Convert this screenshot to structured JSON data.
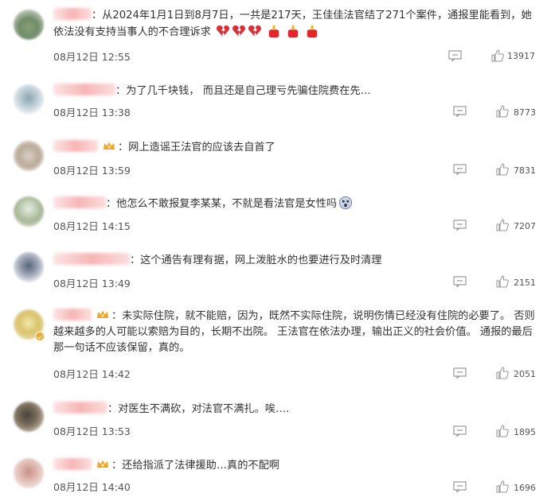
{
  "comments": [
    {
      "text": "：从2024年1月1日到8月7日，一共是217天，王佳佳法官结了271个案件，通报里能看到，她依法没有支持当事人的不合理诉求",
      "time": "08月12日 12:55",
      "likes": "13917"
    },
    {
      "text": "：为了几千块钱， 而且还是自己理亏先骗住院费在先…",
      "time": "08月12日 13:38",
      "likes": "8773"
    },
    {
      "text": "：网上造谣王法官的应该去自首了",
      "time": "08月12日 13:59",
      "likes": "7831"
    },
    {
      "text": "：他怎么不敢报复李某某，不就是看法官是女性吗",
      "time": "08月12日 14:15",
      "likes": "7207"
    },
    {
      "text": "：这个通告有理有据，网上泼脏水的也要进行及时清理",
      "time": "08月12日 13:49",
      "likes": "2151"
    },
    {
      "text": "：未实际住院，就不能赔，因为，既然不实际住院，说明伤情已经没有住院的必要了。 否则越来越多的人可能以索赔为目的，长期不出院。 王法官在依法办理，输出正义的社会价值。 通报的最后那一句话不应该保留，真的。",
      "time": "08月12日 14:42",
      "likes": "2051"
    },
    {
      "text": "：对医生不满砍，对法官不满扎。唉….",
      "time": "08月12日 13:53",
      "likes": "1895"
    },
    {
      "text": "：还给指派了法律援助…真的不配啊",
      "time": "08月12日 14:40",
      "likes": "1696"
    }
  ],
  "icons": {
    "reply": "comment-icon",
    "like": "thumbs-up-icon",
    "crown": "crown-badge-icon",
    "heart": "broken-heart-emoji",
    "candle": "candle-emoji",
    "face": "scared-face-emoji"
  },
  "colors": {
    "text": "#333333",
    "meta": "#555555",
    "icon": "#999999",
    "crown": "#f5a623"
  }
}
